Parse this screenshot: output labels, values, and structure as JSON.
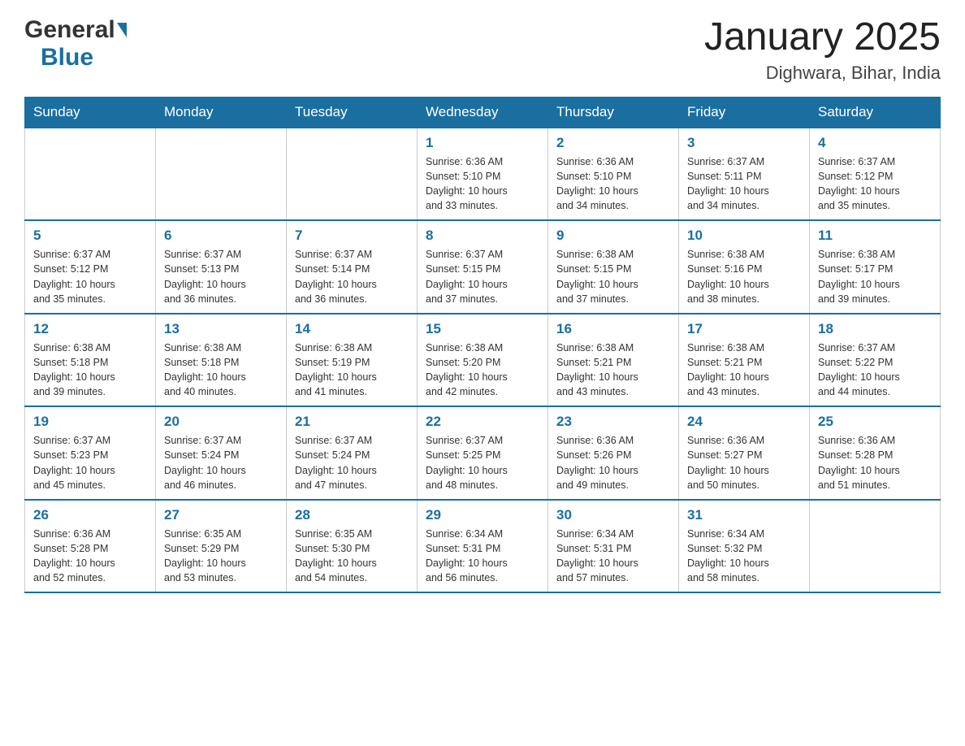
{
  "header": {
    "logo_general": "General",
    "logo_blue": "Blue",
    "title": "January 2025",
    "subtitle": "Dighwara, Bihar, India"
  },
  "weekdays": [
    "Sunday",
    "Monday",
    "Tuesday",
    "Wednesday",
    "Thursday",
    "Friday",
    "Saturday"
  ],
  "weeks": [
    [
      {
        "day": "",
        "info": ""
      },
      {
        "day": "",
        "info": ""
      },
      {
        "day": "",
        "info": ""
      },
      {
        "day": "1",
        "info": "Sunrise: 6:36 AM\nSunset: 5:10 PM\nDaylight: 10 hours\nand 33 minutes."
      },
      {
        "day": "2",
        "info": "Sunrise: 6:36 AM\nSunset: 5:10 PM\nDaylight: 10 hours\nand 34 minutes."
      },
      {
        "day": "3",
        "info": "Sunrise: 6:37 AM\nSunset: 5:11 PM\nDaylight: 10 hours\nand 34 minutes."
      },
      {
        "day": "4",
        "info": "Sunrise: 6:37 AM\nSunset: 5:12 PM\nDaylight: 10 hours\nand 35 minutes."
      }
    ],
    [
      {
        "day": "5",
        "info": "Sunrise: 6:37 AM\nSunset: 5:12 PM\nDaylight: 10 hours\nand 35 minutes."
      },
      {
        "day": "6",
        "info": "Sunrise: 6:37 AM\nSunset: 5:13 PM\nDaylight: 10 hours\nand 36 minutes."
      },
      {
        "day": "7",
        "info": "Sunrise: 6:37 AM\nSunset: 5:14 PM\nDaylight: 10 hours\nand 36 minutes."
      },
      {
        "day": "8",
        "info": "Sunrise: 6:37 AM\nSunset: 5:15 PM\nDaylight: 10 hours\nand 37 minutes."
      },
      {
        "day": "9",
        "info": "Sunrise: 6:38 AM\nSunset: 5:15 PM\nDaylight: 10 hours\nand 37 minutes."
      },
      {
        "day": "10",
        "info": "Sunrise: 6:38 AM\nSunset: 5:16 PM\nDaylight: 10 hours\nand 38 minutes."
      },
      {
        "day": "11",
        "info": "Sunrise: 6:38 AM\nSunset: 5:17 PM\nDaylight: 10 hours\nand 39 minutes."
      }
    ],
    [
      {
        "day": "12",
        "info": "Sunrise: 6:38 AM\nSunset: 5:18 PM\nDaylight: 10 hours\nand 39 minutes."
      },
      {
        "day": "13",
        "info": "Sunrise: 6:38 AM\nSunset: 5:18 PM\nDaylight: 10 hours\nand 40 minutes."
      },
      {
        "day": "14",
        "info": "Sunrise: 6:38 AM\nSunset: 5:19 PM\nDaylight: 10 hours\nand 41 minutes."
      },
      {
        "day": "15",
        "info": "Sunrise: 6:38 AM\nSunset: 5:20 PM\nDaylight: 10 hours\nand 42 minutes."
      },
      {
        "day": "16",
        "info": "Sunrise: 6:38 AM\nSunset: 5:21 PM\nDaylight: 10 hours\nand 43 minutes."
      },
      {
        "day": "17",
        "info": "Sunrise: 6:38 AM\nSunset: 5:21 PM\nDaylight: 10 hours\nand 43 minutes."
      },
      {
        "day": "18",
        "info": "Sunrise: 6:37 AM\nSunset: 5:22 PM\nDaylight: 10 hours\nand 44 minutes."
      }
    ],
    [
      {
        "day": "19",
        "info": "Sunrise: 6:37 AM\nSunset: 5:23 PM\nDaylight: 10 hours\nand 45 minutes."
      },
      {
        "day": "20",
        "info": "Sunrise: 6:37 AM\nSunset: 5:24 PM\nDaylight: 10 hours\nand 46 minutes."
      },
      {
        "day": "21",
        "info": "Sunrise: 6:37 AM\nSunset: 5:24 PM\nDaylight: 10 hours\nand 47 minutes."
      },
      {
        "day": "22",
        "info": "Sunrise: 6:37 AM\nSunset: 5:25 PM\nDaylight: 10 hours\nand 48 minutes."
      },
      {
        "day": "23",
        "info": "Sunrise: 6:36 AM\nSunset: 5:26 PM\nDaylight: 10 hours\nand 49 minutes."
      },
      {
        "day": "24",
        "info": "Sunrise: 6:36 AM\nSunset: 5:27 PM\nDaylight: 10 hours\nand 50 minutes."
      },
      {
        "day": "25",
        "info": "Sunrise: 6:36 AM\nSunset: 5:28 PM\nDaylight: 10 hours\nand 51 minutes."
      }
    ],
    [
      {
        "day": "26",
        "info": "Sunrise: 6:36 AM\nSunset: 5:28 PM\nDaylight: 10 hours\nand 52 minutes."
      },
      {
        "day": "27",
        "info": "Sunrise: 6:35 AM\nSunset: 5:29 PM\nDaylight: 10 hours\nand 53 minutes."
      },
      {
        "day": "28",
        "info": "Sunrise: 6:35 AM\nSunset: 5:30 PM\nDaylight: 10 hours\nand 54 minutes."
      },
      {
        "day": "29",
        "info": "Sunrise: 6:34 AM\nSunset: 5:31 PM\nDaylight: 10 hours\nand 56 minutes."
      },
      {
        "day": "30",
        "info": "Sunrise: 6:34 AM\nSunset: 5:31 PM\nDaylight: 10 hours\nand 57 minutes."
      },
      {
        "day": "31",
        "info": "Sunrise: 6:34 AM\nSunset: 5:32 PM\nDaylight: 10 hours\nand 58 minutes."
      },
      {
        "day": "",
        "info": ""
      }
    ]
  ]
}
